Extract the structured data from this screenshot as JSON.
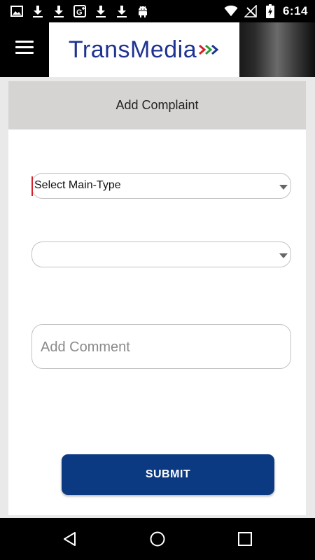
{
  "status_bar": {
    "left_icons": [
      "image-icon",
      "download-icon",
      "download-icon",
      "google-plus-icon",
      "download-icon",
      "download-icon",
      "android-icon"
    ],
    "right_icons": [
      "wifi-icon",
      "no-signal-icon",
      "battery-charging-icon"
    ],
    "time": "6:14"
  },
  "header": {
    "logo_text": "TransMedia",
    "brand_color": "#1f3390",
    "arrow_colors": [
      "#d2232a",
      "#2e9a3c",
      "#1f3390"
    ]
  },
  "form": {
    "title": "Add Complaint",
    "main_type": {
      "value": "Select Main-Type"
    },
    "sub_type": {
      "value": ""
    },
    "comment": {
      "placeholder": "Add Comment",
      "value": ""
    },
    "submit_label": "SUBMIT",
    "submit_color": "#0c3a82"
  },
  "nav_bar": {
    "icons": [
      "back-icon",
      "home-icon",
      "recents-icon"
    ]
  }
}
